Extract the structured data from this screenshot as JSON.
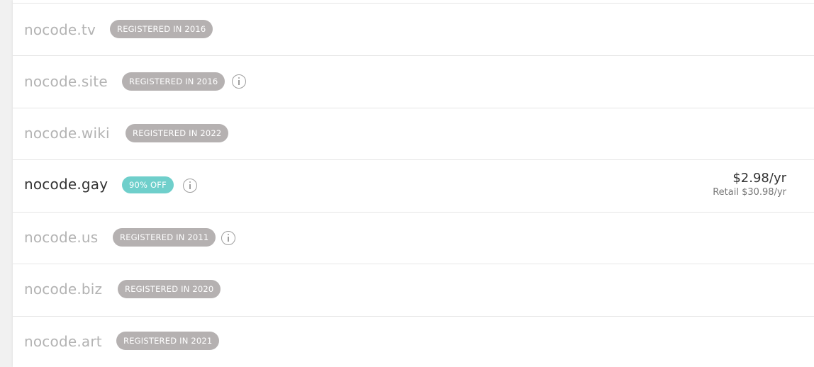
{
  "domains": [
    {
      "name": "nocode.tv",
      "badge": "REGISTERED IN 2016"
    },
    {
      "name": "nocode.site",
      "badge": "REGISTERED IN 2016",
      "info_icon": "info-circle-icon"
    },
    {
      "name": "nocode.wiki",
      "badge": "REGISTERED IN 2022"
    },
    {
      "name": "nocode.gay",
      "badge": "90% OFF",
      "info_icon": "info-circle-icon",
      "price": "$2.98/yr",
      "retail": "Retail $30.98/yr"
    },
    {
      "name": "nocode.us",
      "badge": "REGISTERED IN 2011",
      "info_icon": "info-circle-icon"
    },
    {
      "name": "nocode.biz",
      "badge": "REGISTERED IN 2020"
    },
    {
      "name": "nocode.art",
      "badge": "REGISTERED IN 2021"
    }
  ],
  "colors": {
    "registered_badge": "#b5b1b1",
    "discount_badge": "#6fcfcb",
    "taken_text": "#b3b3b3",
    "available_text": "#333333"
  }
}
